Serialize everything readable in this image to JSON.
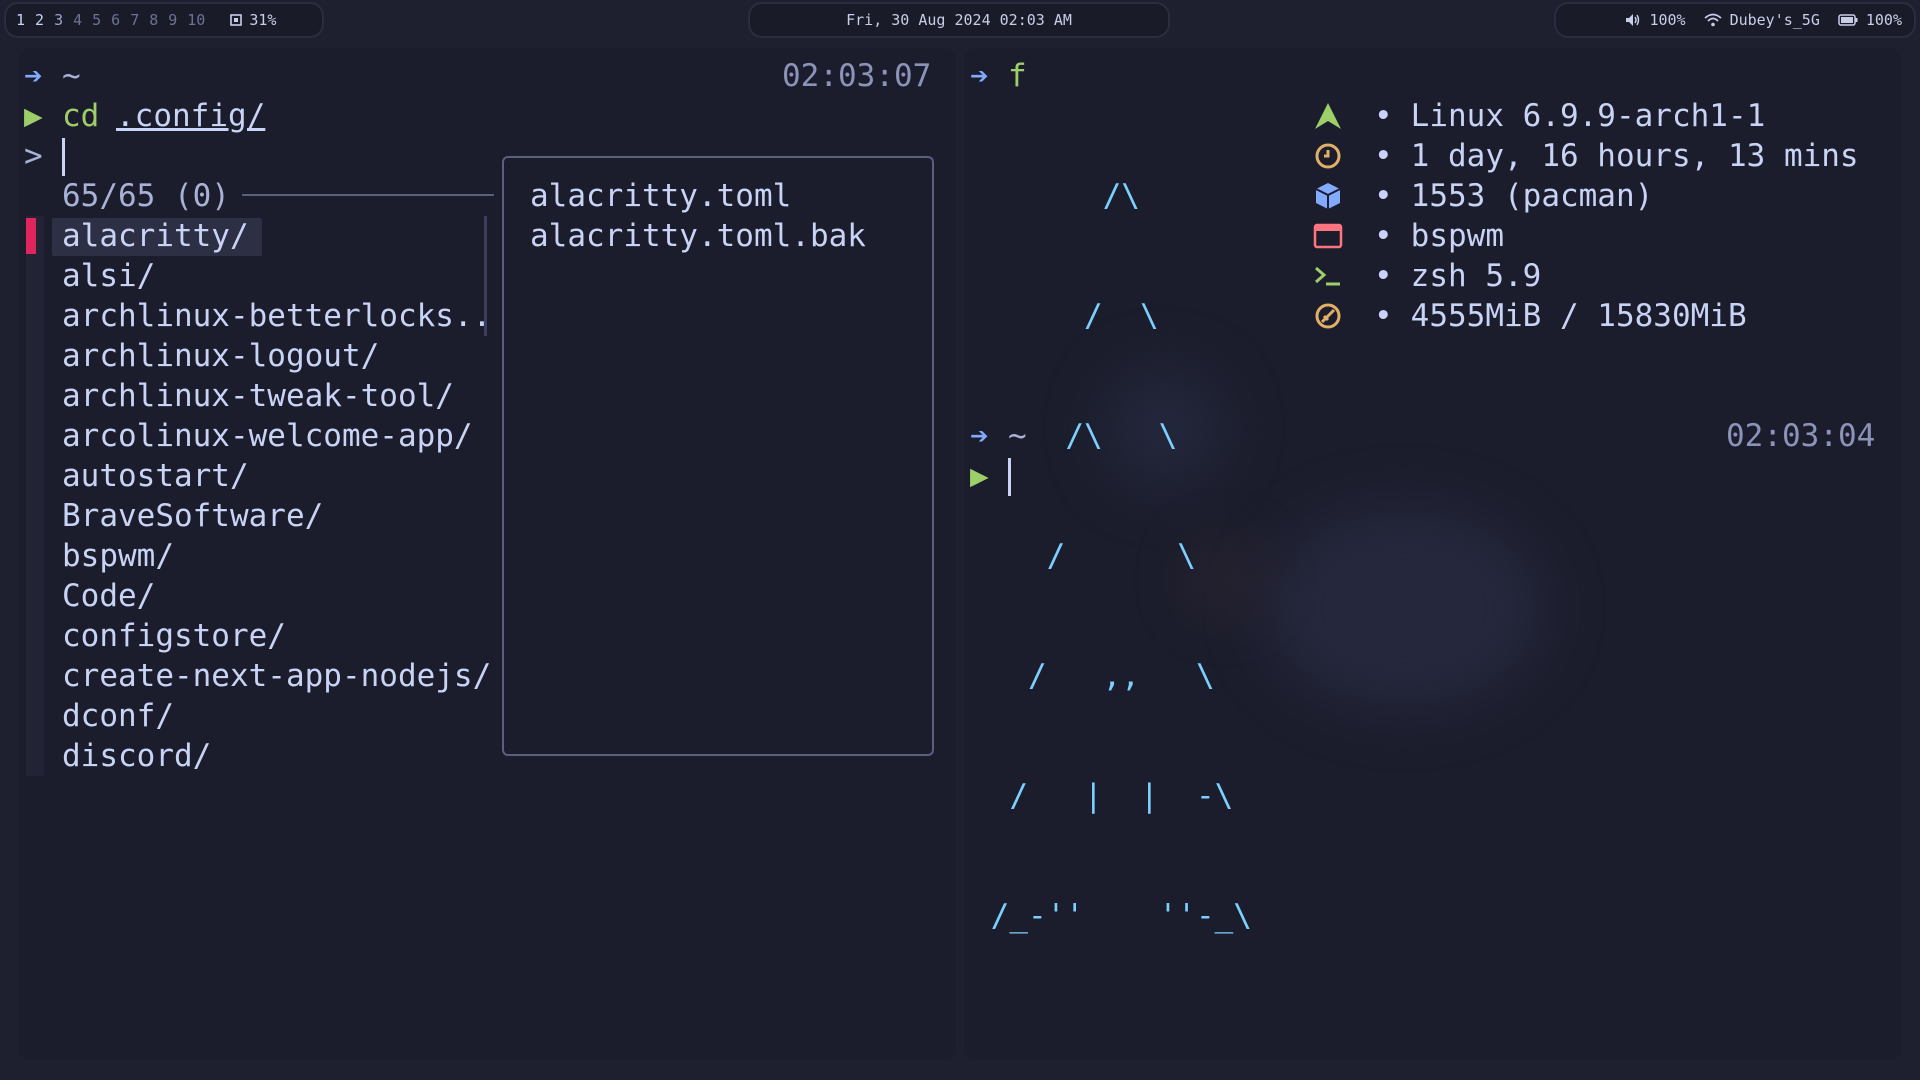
{
  "topbar": {
    "workspaces": [
      "1",
      "2",
      "3",
      "4",
      "5",
      "6",
      "7",
      "8",
      "9",
      "10"
    ],
    "cpu_label": "31%",
    "datetime": "Fri, 30 Aug 2024 02:03 AM",
    "volume": "100%",
    "wifi": "Dubey's_5G",
    "battery": "100%"
  },
  "left_terminal": {
    "prompt_dir": "~",
    "clock": "02:03:07",
    "command": "cd",
    "command_arg": ".config/",
    "fzf_prompt": ">",
    "match_count": "65/65 (0)",
    "items": [
      "alacritty/",
      "alsi/",
      "archlinux-betterlocks..",
      "archlinux-logout/",
      "archlinux-tweak-tool/",
      "arcolinux-welcome-app/",
      "autostart/",
      "BraveSoftware/",
      "bspwm/",
      "Code/",
      "configstore/",
      "create-next-app-nodejs/",
      "dconf/",
      "discord/"
    ],
    "preview_files": [
      "alacritty.toml",
      "alacritty.toml.bak"
    ]
  },
  "right_terminal": {
    "command": "f",
    "ascii_art": [
      "       /\\",
      "      /  \\",
      "     /\\   \\",
      "    /      \\",
      "   /   ,,   \\",
      "  /   |  |  -\\",
      " /_-''    ''-_\\"
    ],
    "info": [
      {
        "icon": "arch-icon",
        "text": "Linux 6.9.9-arch1-1"
      },
      {
        "icon": "clock-icon",
        "text": "1 day, 16 hours, 13 mins"
      },
      {
        "icon": "package-icon",
        "text": "1553 (pacman)"
      },
      {
        "icon": "window-icon",
        "text": "bspwm"
      },
      {
        "icon": "shell-icon",
        "text": "zsh 5.9"
      },
      {
        "icon": "memory-icon",
        "text": "4555MiB / 15830MiB"
      }
    ],
    "bullet": "•",
    "prompt_dir": "~",
    "clock": "02:03:04"
  },
  "colors": {
    "background": "#1e2030",
    "terminal_bg": "#1b1d2c",
    "accent_blue": "#82aaff",
    "accent_green": "#9ece6a",
    "fzf_marker": "#e0245e",
    "ascii_cyan": "#7dcfff",
    "icon_green": "#9ece6a",
    "icon_yellow": "#e0af68",
    "icon_blue": "#82aaff",
    "icon_red": "#ff757f"
  }
}
